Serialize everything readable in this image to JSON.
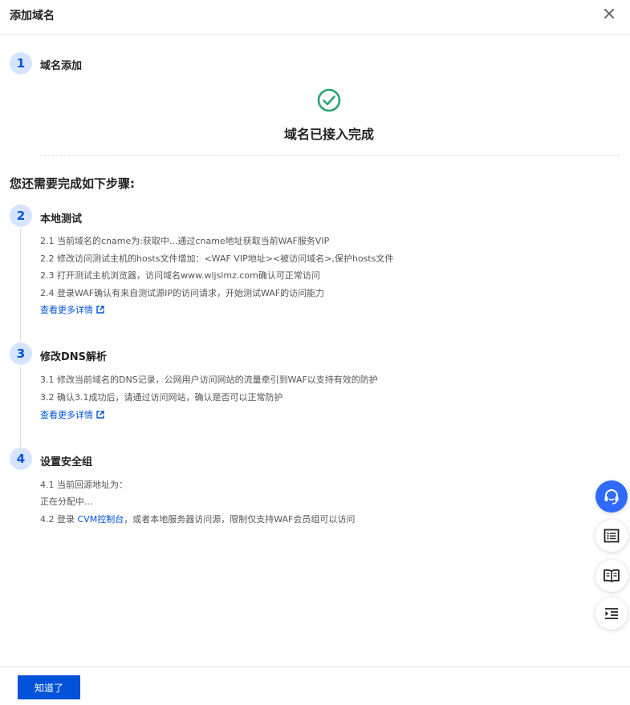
{
  "dialog": {
    "title": "添加域名"
  },
  "step1": {
    "number": "1",
    "title": "域名添加",
    "status_text": "域名已接入完成"
  },
  "section_title": "您还需要完成如下步骤:",
  "step2": {
    "number": "2",
    "title": "本地测试",
    "lines": [
      "2.1 当前域名的cname为:获取中...通过cname地址获取当前WAF服务VIP",
      "2.2 修改访问测试主机的hosts文件增加：<WAF VIP地址><被访问域名>,保护hosts文件",
      "2.3 打开测试主机浏览器，访问域名www.wljslmz.com确认可正常访问",
      "2.4 登录WAF确认有来自测试源IP的访问请求，开始测试WAF的访问能力"
    ],
    "link": "查看更多详情"
  },
  "step3": {
    "number": "3",
    "title": "修改DNS解析",
    "lines": [
      "3.1 修改当前域名的DNS记录，公网用户访问网站的流量牵引到WAF以支持有效的防护",
      "3.2 确认3.1成功后，请通过访问网站，确认是否可以正常防护"
    ],
    "link": "查看更多详情"
  },
  "step4": {
    "number": "4",
    "title": "设置安全组",
    "line1": "4.1 当前回源地址为：",
    "line2": "正在分配中...",
    "line3_prefix": "4.2 登录 ",
    "line3_link": "CVM控制台",
    "line3_suffix": "，或者本地服务器访问源，限制仅支持WAF会员组可以访问"
  },
  "footer": {
    "ok_label": "知道了"
  },
  "colors": {
    "primary": "#0052d9",
    "success": "#2ba471",
    "step_bg": "#d6e4ff"
  },
  "floating_icons": [
    "headset-icon",
    "list-icon",
    "book-icon",
    "indent-icon"
  ]
}
